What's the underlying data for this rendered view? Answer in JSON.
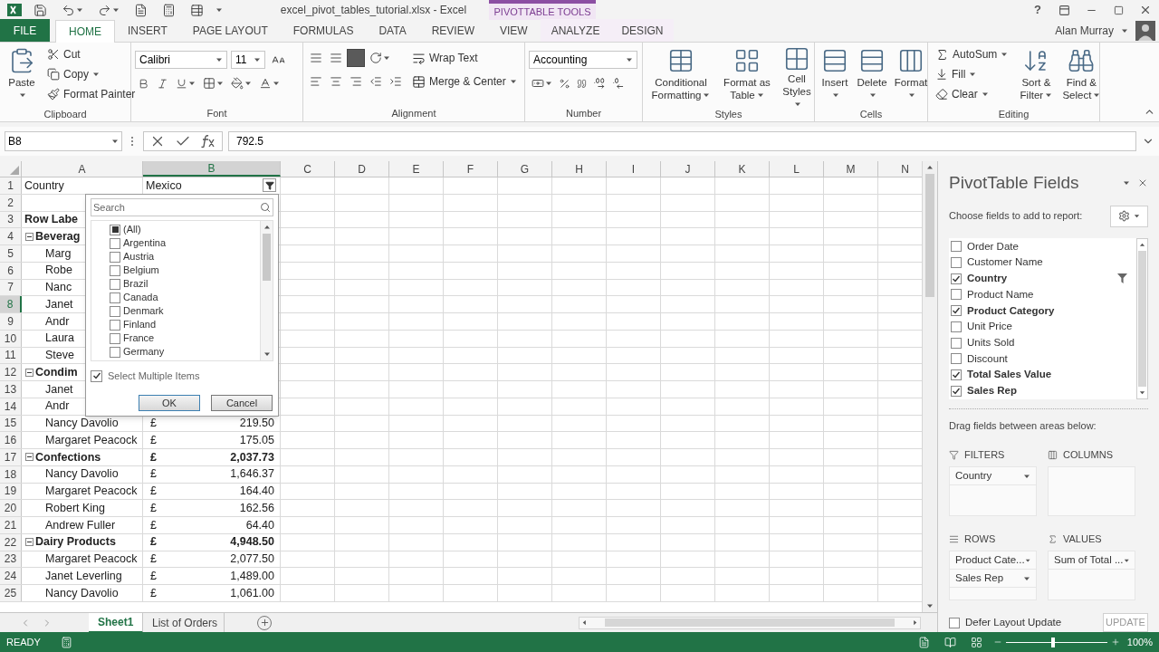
{
  "title_bar": {
    "title": "excel_pivot_tables_tutorial.xlsx - Excel",
    "context_label": "PIVOTTABLE TOOLS",
    "help": "?"
  },
  "tabs": [
    {
      "label": "FILE",
      "kind": "file",
      "selected": false
    },
    {
      "label": "HOME",
      "kind": "normal",
      "selected": true
    },
    {
      "label": "INSERT",
      "kind": "normal",
      "selected": false
    },
    {
      "label": "PAGE LAYOUT",
      "kind": "normal",
      "selected": false
    },
    {
      "label": "FORMULAS",
      "kind": "normal",
      "selected": false
    },
    {
      "label": "DATA",
      "kind": "normal",
      "selected": false
    },
    {
      "label": "REVIEW",
      "kind": "normal",
      "selected": false
    },
    {
      "label": "VIEW",
      "kind": "normal",
      "selected": false
    },
    {
      "label": "ANALYZE",
      "kind": "context",
      "selected": false
    },
    {
      "label": "DESIGN",
      "kind": "context",
      "selected": false
    }
  ],
  "user": {
    "name": "Alan Murray"
  },
  "ribbon": {
    "clipboard": {
      "label": "Clipboard",
      "paste": "Paste",
      "cut": "Cut",
      "copy": "Copy",
      "format_painter": "Format Painter"
    },
    "font": {
      "label": "Font",
      "font_name": "Calibri",
      "font_size": "11"
    },
    "alignment": {
      "label": "Alignment",
      "wrap_text": "Wrap Text",
      "merge_center": "Merge & Center"
    },
    "number": {
      "label": "Number",
      "format": "Accounting"
    },
    "styles": {
      "label": "Styles",
      "conditional_formatting": "Conditional Formatting",
      "format_as_table": "Format as Table",
      "cell_styles": "Cell Styles"
    },
    "cells": {
      "label": "Cells",
      "insert": "Insert",
      "delete": "Delete",
      "format": "Format"
    },
    "editing": {
      "label": "Editing",
      "autosum": "AutoSum",
      "fill": "Fill",
      "clear": "Clear",
      "sort_filter": "Sort & Filter",
      "find_select": "Find & Select"
    }
  },
  "formula_bar": {
    "name_box": "B8",
    "value": "792.5"
  },
  "grid": {
    "columns": [
      {
        "label": "A",
        "selected": false
      },
      {
        "label": "B",
        "selected": true
      },
      {
        "label": "C",
        "selected": false
      },
      {
        "label": "D",
        "selected": false
      },
      {
        "label": "E",
        "selected": false
      },
      {
        "label": "F",
        "selected": false
      },
      {
        "label": "G",
        "selected": false
      },
      {
        "label": "H",
        "selected": false
      },
      {
        "label": "I",
        "selected": false
      },
      {
        "label": "J",
        "selected": false
      },
      {
        "label": "K",
        "selected": false
      },
      {
        "label": "L",
        "selected": false
      },
      {
        "label": "M",
        "selected": false
      },
      {
        "label": "N",
        "selected": false
      }
    ],
    "rows": [
      {
        "number": "1",
        "kind": "filter",
        "label": "Country",
        "filter_value": "Mexico",
        "selected": false
      },
      {
        "number": "2",
        "kind": "blank",
        "selected": false
      },
      {
        "number": "3",
        "kind": "label",
        "label": "Row Labe",
        "selected": false
      },
      {
        "number": "4",
        "kind": "group",
        "label": "Beverag",
        "expanded": true,
        "selected": false
      },
      {
        "number": "5",
        "kind": "item",
        "label": "Marg",
        "selected": false
      },
      {
        "number": "6",
        "kind": "item",
        "label": "Robe",
        "selected": false
      },
      {
        "number": "7",
        "kind": "item",
        "label": "Nanc",
        "selected": false
      },
      {
        "number": "8",
        "kind": "item",
        "label": "Janet",
        "selected": true
      },
      {
        "number": "9",
        "kind": "item",
        "label": "Andr",
        "selected": false
      },
      {
        "number": "10",
        "kind": "item",
        "label": "Laura",
        "selected": false
      },
      {
        "number": "11",
        "kind": "item",
        "label": "Steve",
        "selected": false
      },
      {
        "number": "12",
        "kind": "group",
        "label": "Condim",
        "expanded": true,
        "selected": false
      },
      {
        "number": "13",
        "kind": "item",
        "label": "Janet",
        "selected": false
      },
      {
        "number": "14",
        "kind": "item",
        "label": "Andr",
        "selected": false
      },
      {
        "number": "15",
        "kind": "item",
        "label": "Nancy Davolio",
        "currency": "£",
        "value": "219.50",
        "selected": false
      },
      {
        "number": "16",
        "kind": "item",
        "label": "Margaret Peacock",
        "currency": "£",
        "value": "175.05",
        "selected": false
      },
      {
        "number": "17",
        "kind": "group",
        "label": "Confections",
        "expanded": true,
        "currency": "£",
        "value": "2,037.73",
        "selected": false
      },
      {
        "number": "18",
        "kind": "item",
        "label": "Nancy Davolio",
        "currency": "£",
        "value": "1,646.37",
        "selected": false
      },
      {
        "number": "19",
        "kind": "item",
        "label": "Margaret Peacock",
        "currency": "£",
        "value": "164.40",
        "selected": false
      },
      {
        "number": "20",
        "kind": "item",
        "label": "Robert King",
        "currency": "£",
        "value": "162.56",
        "selected": false
      },
      {
        "number": "21",
        "kind": "item",
        "label": "Andrew Fuller",
        "currency": "£",
        "value": "64.40",
        "selected": false
      },
      {
        "number": "22",
        "kind": "group",
        "label": "Dairy Products",
        "expanded": true,
        "currency": "£",
        "value": "4,948.50",
        "selected": false
      },
      {
        "number": "23",
        "kind": "item",
        "label": "Margaret Peacock",
        "currency": "£",
        "value": "2,077.50",
        "selected": false
      },
      {
        "number": "24",
        "kind": "item",
        "label": "Janet Leverling",
        "currency": "£",
        "value": "1,489.00",
        "selected": false
      },
      {
        "number": "25",
        "kind": "item",
        "label": "Nancy Davolio",
        "currency": "£",
        "value": "1,061.00",
        "selected": false
      }
    ]
  },
  "filter_popup": {
    "search_placeholder": "Search",
    "items": [
      {
        "label": "(All)",
        "checked": false,
        "indeterminate": true
      },
      {
        "label": "Argentina",
        "checked": false,
        "indeterminate": false
      },
      {
        "label": "Austria",
        "checked": false,
        "indeterminate": false
      },
      {
        "label": "Belgium",
        "checked": false,
        "indeterminate": false
      },
      {
        "label": "Brazil",
        "checked": false,
        "indeterminate": false
      },
      {
        "label": "Canada",
        "checked": false,
        "indeterminate": false
      },
      {
        "label": "Denmark",
        "checked": false,
        "indeterminate": false
      },
      {
        "label": "Finland",
        "checked": false,
        "indeterminate": false
      },
      {
        "label": "France",
        "checked": false,
        "indeterminate": false
      },
      {
        "label": "Germany",
        "checked": false,
        "indeterminate": false
      }
    ],
    "multi_select": {
      "label": "Select Multiple Items",
      "checked": true
    },
    "ok": "OK",
    "cancel": "Cancel"
  },
  "sheet_tabs": [
    {
      "label": "Sheet1",
      "selected": true
    },
    {
      "label": "List of Orders",
      "selected": false
    }
  ],
  "pivot_pane": {
    "title": "PivotTable Fields",
    "subtitle": "Choose fields to add to report:",
    "fields": [
      {
        "label": "Order Date",
        "checked": false,
        "filtered": false
      },
      {
        "label": "Customer Name",
        "checked": false,
        "filtered": false
      },
      {
        "label": "Country",
        "checked": true,
        "filtered": true
      },
      {
        "label": "Product Name",
        "checked": false,
        "filtered": false
      },
      {
        "label": "Product Category",
        "checked": true,
        "filtered": false
      },
      {
        "label": "Unit Price",
        "checked": false,
        "filtered": false
      },
      {
        "label": "Units Sold",
        "checked": false,
        "filtered": false
      },
      {
        "label": "Discount",
        "checked": false,
        "filtered": false
      },
      {
        "label": "Total Sales Value",
        "checked": true,
        "filtered": false
      },
      {
        "label": "Sales Rep",
        "checked": true,
        "filtered": false
      }
    ],
    "drag_hint": "Drag fields between areas below:",
    "filters": {
      "label": "FILTERS",
      "items": [
        "Country"
      ]
    },
    "columns": {
      "label": "COLUMNS"
    },
    "rows": {
      "label": "ROWS",
      "items": [
        "Product Cate...",
        "Sales Rep"
      ]
    },
    "values": {
      "label": "VALUES",
      "items": [
        "Sum of Total ..."
      ]
    },
    "defer": {
      "label": "Defer Layout Update",
      "checked": false
    },
    "update": "UPDATE"
  },
  "status_bar": {
    "status": "READY",
    "zoom": "100%",
    "zoom_slider": {
      "level": 0.47
    }
  }
}
